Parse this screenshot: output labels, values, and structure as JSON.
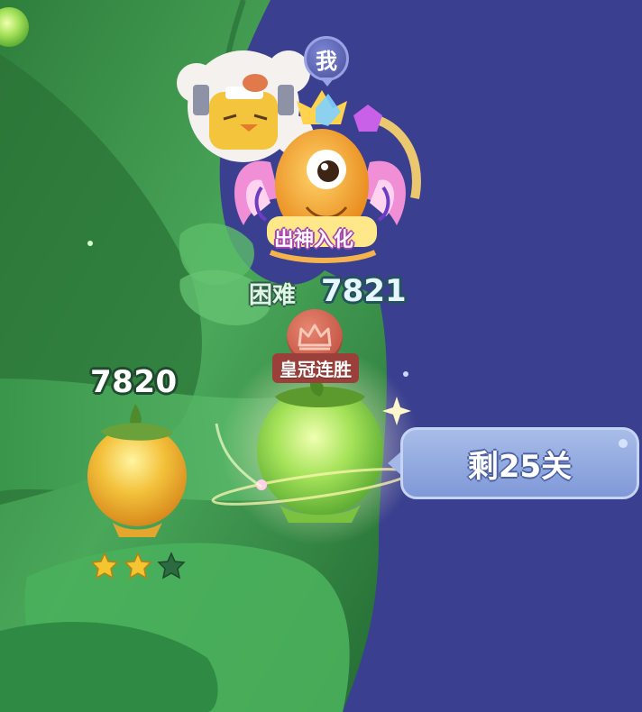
{
  "levels": {
    "previous": {
      "number": "7820",
      "stars_earned": 2,
      "stars_total": 3
    },
    "current": {
      "difficulty": "困难",
      "number": "7821",
      "badge": "皇冠连胜"
    }
  },
  "player": {
    "tag": "我",
    "title": "出神入化"
  },
  "remaining": {
    "text": "剩25关"
  },
  "colors": {
    "background": "#3a3f8f",
    "vine": "#3f9a4c",
    "remaining_box": "#8fa6e0",
    "crown_badge": "#c95745",
    "star_gold": "#f5c531",
    "star_empty": "#2c6a3f"
  },
  "icons": {
    "star_filled": "star-filled-icon",
    "star_empty": "star-empty-icon",
    "crown": "crown-icon"
  }
}
